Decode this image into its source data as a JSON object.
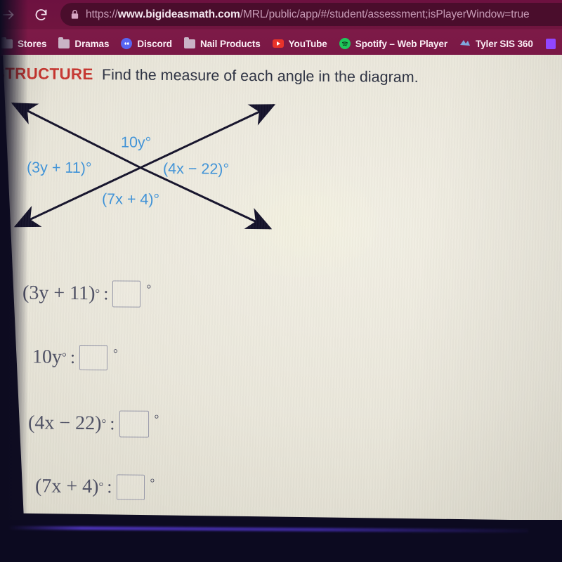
{
  "browser": {
    "forward_icon": "forward-arrow-icon",
    "reload_icon": "reload-icon",
    "lock_icon": "lock-icon",
    "url_secure_prefix": "https://",
    "url_domain": "www.bigideasmath.com",
    "url_path": "/MRL/public/app/#/student/assessment;isPlayerWindow=true",
    "url_full": "https://www.bigideasmath.com/MRL/public/app/#/student/assessment;isPlayerWindow=true",
    "bookmarks": [
      {
        "label": "Stores",
        "icon": "folder-icon"
      },
      {
        "label": "Dramas",
        "icon": "folder-icon"
      },
      {
        "label": "Discord",
        "icon": "discord-icon"
      },
      {
        "label": "Nail Products",
        "icon": "folder-icon"
      },
      {
        "label": "YouTube",
        "icon": "youtube-icon"
      },
      {
        "label": "Spotify – Web Player",
        "icon": "spotify-icon"
      },
      {
        "label": "Tyler SIS 360",
        "icon": "tyler-sis-icon"
      },
      {
        "label": "",
        "icon": "twitch-icon"
      }
    ]
  },
  "question": {
    "tag": "STRUCTURE",
    "prompt": "Find the measure of each angle in the diagram.",
    "tag_color": "#c6352f"
  },
  "diagram": {
    "label_color": "#3f92d8",
    "line_color": "#14122a",
    "labels": {
      "top": "10y°",
      "left": "(3y + 11)°",
      "right": "(4x − 22)°",
      "bottom": "(7x + 4)°"
    }
  },
  "answers": [
    {
      "expression": "(3y + 11)",
      "degree": "°",
      "separator": ":",
      "value": "",
      "unit": "°"
    },
    {
      "expression": "10y",
      "degree": "°",
      "separator": ":",
      "value": "",
      "unit": "°"
    },
    {
      "expression": "(4x − 22)",
      "degree": "°",
      "separator": ":",
      "value": "",
      "unit": "°"
    },
    {
      "expression": "(7x + 4)",
      "degree": "°",
      "separator": ":",
      "value": "",
      "unit": "°"
    }
  ]
}
